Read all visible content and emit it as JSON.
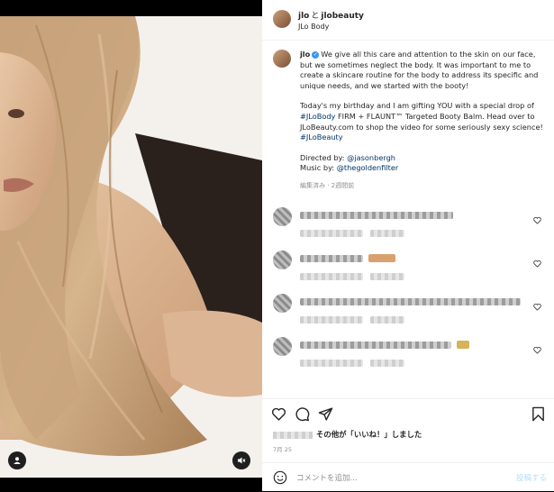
{
  "header": {
    "username1": "jlo",
    "conj": "と",
    "username2": "jlobeauty",
    "subtitle": "JLo Body"
  },
  "caption": {
    "username": "jlo",
    "paragraph1": "We give all this care and attention to the skin on our face, but we sometimes neglect the body. It was important to me to create a skincare routine for the body to address its specific and unique needs, and we started with the booty!",
    "p2_part1": "Today's my birthday and I am gifting YOU with a special drop of ",
    "hashtag1": "#JLoBody",
    "p2_part2": " FIRM + FLAUNT™ Targeted Booty Balm. Head over to JLoBeauty.com to shop the video for some seriously sexy science! ",
    "hashtag2": "#JLoBeauty",
    "directed_label": "Directed by: ",
    "director": "@jasonbergh",
    "music_label": "Music by: ",
    "musician": "@thegoldenfilter",
    "meta": "編集済み · 2週間前"
  },
  "comments": [
    {
      "has_emoji": false
    },
    {
      "has_emoji": true,
      "emoji_color": "#d9a070"
    },
    {
      "has_emoji": false
    },
    {
      "has_emoji": true,
      "emoji_color": "#d6b25a"
    }
  ],
  "actions": {
    "likes_text": "その他が「いいね！」しました",
    "date": "7月 25"
  },
  "add_comment": {
    "placeholder": "コメントを追加...",
    "post_label": "投稿する"
  },
  "colors": {
    "link": "#00376b",
    "verified": "#3897f0",
    "meta": "#8e8e8e",
    "post_disabled": "#b2dffc"
  }
}
